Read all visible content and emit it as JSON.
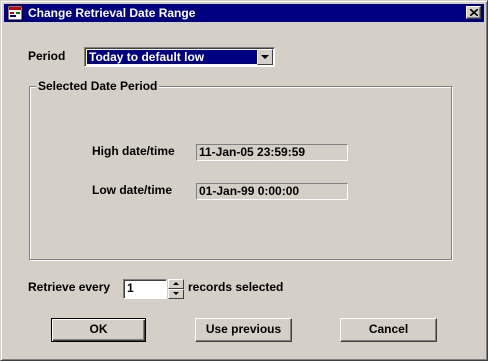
{
  "window": {
    "title": "Change Retrieval Date Range"
  },
  "period": {
    "label": "Period",
    "selected": "Today to default low"
  },
  "group": {
    "title": "Selected Date Period"
  },
  "high": {
    "label": "High date/time",
    "value": "11-Jan-05 23:59:59"
  },
  "low": {
    "label": "Low date/time",
    "value": "01-Jan-99 0:00:00"
  },
  "retrieve": {
    "label": "Retrieve every",
    "value": "1",
    "suffix": "records selected"
  },
  "buttons": {
    "ok": "OK",
    "previous": "Use previous",
    "cancel": "Cancel"
  },
  "colors": {
    "titlebar": "#000080",
    "face": "#d4d0c8",
    "selection": "#000080"
  },
  "icons": {
    "app": "app-icon",
    "close": "close-icon",
    "dropdown": "chevron-down-icon"
  }
}
